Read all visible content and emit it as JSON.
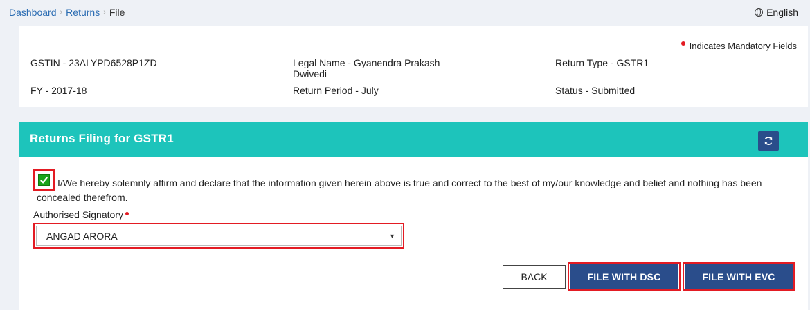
{
  "breadcrumb": {
    "items": [
      "Dashboard",
      "Returns"
    ],
    "current": "File",
    "separator": "›"
  },
  "language": {
    "label": "English",
    "icon": "globe-icon"
  },
  "info": {
    "mandatory_note": "Indicates Mandatory Fields",
    "gstin": "GSTIN - 23ALYPD6528P1ZD",
    "legal_name_line1": "Legal Name - Gyanendra Prakash",
    "legal_name_line2": "Dwivedi",
    "return_type": "Return Type - GSTR1",
    "fy": "FY - 2017-18",
    "return_period": "Return Period - July",
    "status": "Status - Submitted"
  },
  "filing": {
    "title": "Returns Filing for GSTR1",
    "refresh_icon": "refresh-icon",
    "declaration_checked": true,
    "declaration": "I/We hereby solemnly affirm and declare that the information given herein above is true and correct to the best of my/our knowledge and belief and nothing has been concealed therefrom.",
    "signatory_label": "Authorised Signatory",
    "signatory_value": "ANGAD ARORA",
    "buttons": {
      "back": "BACK",
      "file_dsc": "FILE WITH DSC",
      "file_evc": "FILE WITH EVC"
    }
  },
  "colors": {
    "header_teal": "#1dc4bb",
    "button_blue": "#2a4d8b",
    "highlight_red": "#e31b23",
    "checkbox_green": "#1aa31a",
    "link_blue": "#2c6db3"
  }
}
